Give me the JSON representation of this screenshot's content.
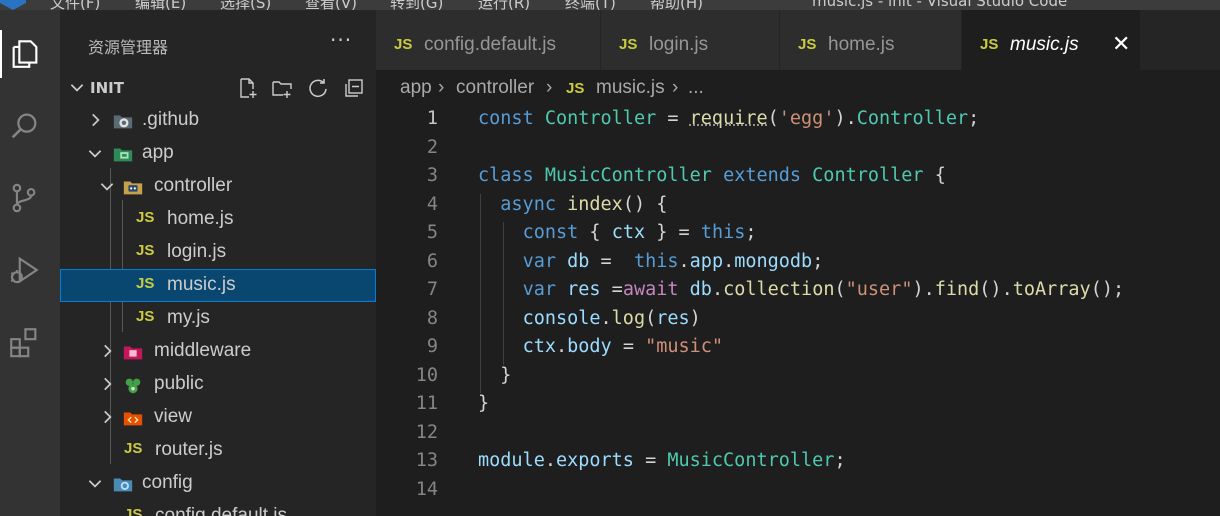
{
  "titlebar": {
    "menus": [
      "文件(F)",
      "编辑(E)",
      "选择(S)",
      "查看(V)",
      "转到(G)",
      "运行(R)",
      "终端(T)",
      "帮助(H)"
    ],
    "window_title": "music.js - init - Visual Studio Code"
  },
  "activity_bar": {
    "items": [
      "explorer-icon",
      "search-icon",
      "source-control-icon",
      "run-debug-icon",
      "extensions-icon"
    ],
    "active": "explorer-icon"
  },
  "sidebar": {
    "title": "资源管理器",
    "more": "···",
    "section": "INIT",
    "section_actions": [
      "new-file-icon",
      "new-folder-icon",
      "refresh-icon",
      "collapse-all-icon"
    ],
    "tree": [
      {
        "label": ".github",
        "kind": "folder",
        "icon": "github-folder-icon",
        "expanded": false
      },
      {
        "label": "app",
        "kind": "folder",
        "icon": "app-folder-icon",
        "expanded": true
      },
      {
        "label": "controller",
        "kind": "folder",
        "icon": "controller-folder-icon",
        "expanded": true
      },
      {
        "label": "home.js",
        "kind": "js"
      },
      {
        "label": "login.js",
        "kind": "js"
      },
      {
        "label": "music.js",
        "kind": "js",
        "selected": true
      },
      {
        "label": "my.js",
        "kind": "js"
      },
      {
        "label": "middleware",
        "kind": "folder",
        "icon": "middleware-folder-icon",
        "expanded": false
      },
      {
        "label": "public",
        "kind": "folder",
        "icon": "public-folder-icon",
        "expanded": false
      },
      {
        "label": "view",
        "kind": "folder",
        "icon": "view-folder-icon",
        "expanded": false
      },
      {
        "label": "router.js",
        "kind": "js"
      },
      {
        "label": "config",
        "kind": "folder",
        "icon": "config-folder-icon",
        "expanded": true
      },
      {
        "label": "config.default.js",
        "kind": "js"
      }
    ],
    "js_badge": "JS"
  },
  "tabs": [
    {
      "label": "config.default.js"
    },
    {
      "label": "login.js"
    },
    {
      "label": "home.js"
    },
    {
      "label": "music.js",
      "active": true
    }
  ],
  "tab_close": "✕",
  "breadcrumb": {
    "parts": [
      "app",
      "controller",
      "music.js",
      "..."
    ],
    "sep": "›"
  },
  "editor": {
    "line_numbers": [
      "1",
      "2",
      "3",
      "4",
      "5",
      "6",
      "7",
      "8",
      "9",
      "10",
      "11",
      "12",
      "13",
      "14"
    ],
    "current_line": 1,
    "lines": [
      "const Controller = require('egg').Controller;",
      "",
      "class MusicController extends Controller {",
      "  async index() {",
      "    const { ctx } = this;",
      "    var db =  this.app.mongodb;",
      "    var res =await db.collection(\"user\").find().toArray();",
      "    console.log(res)",
      "    ctx.body = \"music\"",
      "  }",
      "}",
      "",
      "module.exports = MusicController;",
      ""
    ]
  },
  "colors": {
    "keyword": "#569cd6",
    "class": "#4ec9b0",
    "function": "#dcdcaa",
    "string": "#ce9178",
    "variable": "#9cdcfe",
    "control": "#c586c0",
    "selection": "#094771",
    "js_badge": "#cbcb41"
  }
}
